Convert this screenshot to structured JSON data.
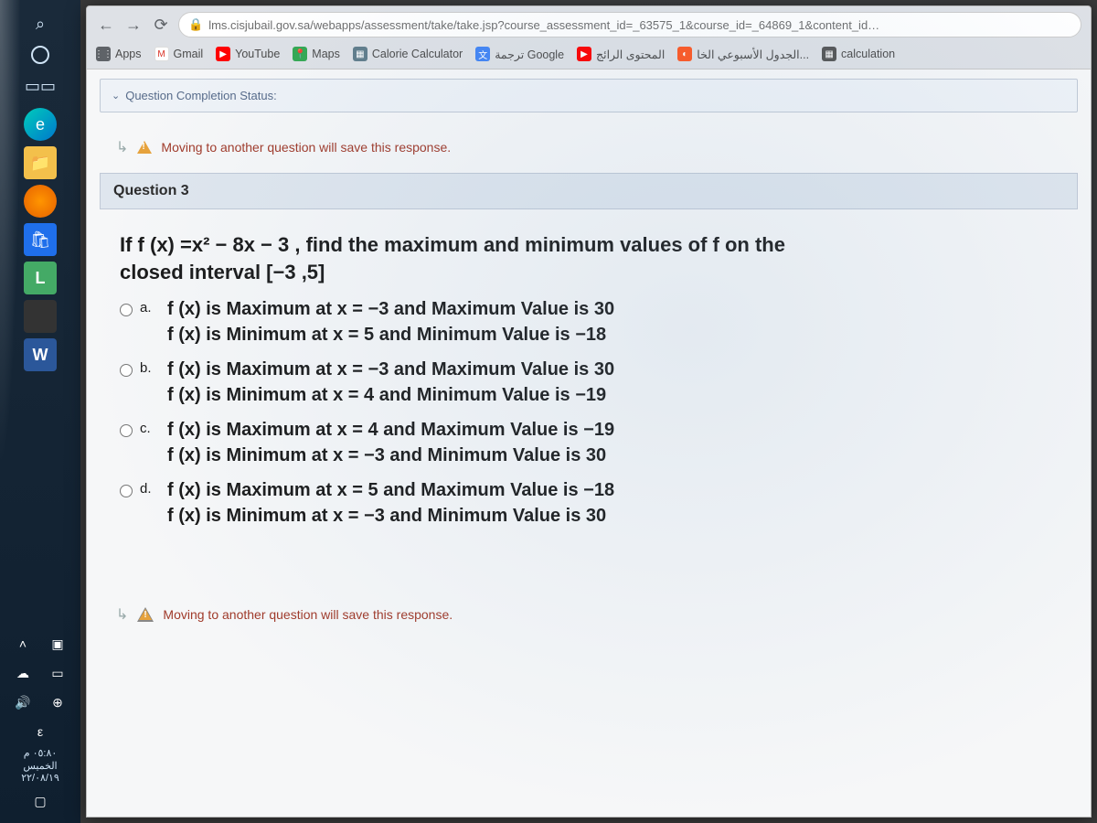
{
  "taskbar": {
    "clock_time": "٠٥:٨٠ م",
    "clock_day": "الخميس",
    "clock_date": "٢٢/٠٨/١٩",
    "lang": "ε"
  },
  "browser": {
    "url": "lms.cisjubail.gov.sa/webapps/assessment/take/take.jsp?course_assessment_id=_63575_1&course_id=_64869_1&content_id…",
    "bookmarks": {
      "apps": "Apps",
      "gmail": "Gmail",
      "youtube": "YouTube",
      "maps": "Maps",
      "calorie": "Calorie Calculator",
      "google_tr": "ترجمة Google",
      "trending": "المحتوى الرائج",
      "weekly": "الجدول الأسبوعي الخا...",
      "calc": "calculation"
    }
  },
  "page": {
    "status_label": "Question Completion Status:",
    "notice_text": "Moving to another question will save this response.",
    "question_label": "Question 3",
    "stem_line1": "If  f (x) =x² − 8x − 3 ,  find the maximum and minimum values of f on the",
    "stem_line2": "closed interval  [−3 ,5]",
    "options": {
      "a": {
        "label": "a.",
        "line1": "f (x)  is Maximum at  x = −3  and  Maximum Value  is  30",
        "line2": "f (x)  is Minimum at  x =   5  and  Minimum Value  is  −18"
      },
      "b": {
        "label": "b.",
        "line1": "f (x)  is Maximum at  x = −3  and  Maximum Value  is  30",
        "line2": "f (x)  is Minimum at  x =   4  and  Minimum Value  is  −19"
      },
      "c": {
        "label": "c.",
        "line1": "f (x)  is Maximum at  x = 4  and  Maximum Value  is  −19",
        "line2": "f (x)  is Minimum at  x = −3  and Minimum Value  is  30"
      },
      "d": {
        "label": "d.",
        "line1": "f (x)  is Maximum at  x =  5  and  Maximum Value  is  −18",
        "line2": "f (x)  is Minimum at  x = −3  and  Minimum Value  is  30"
      }
    }
  }
}
